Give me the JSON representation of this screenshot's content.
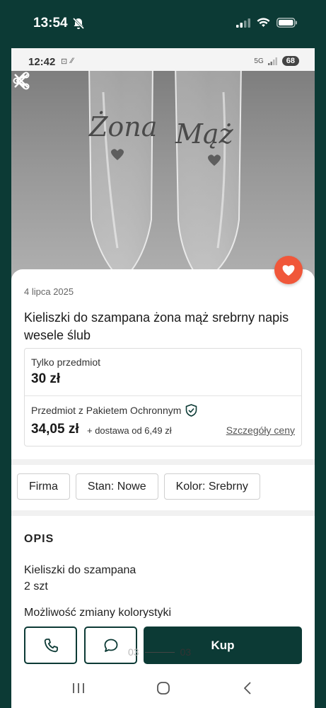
{
  "outer_status": {
    "time": "13:54"
  },
  "inner_status": {
    "time": "12:42",
    "network": "5G",
    "battery": "68"
  },
  "listing": {
    "date": "4 lipca 2025",
    "title": "Kieliszki do szampana żona mąż srebrny napis wesele ślub",
    "photo_text": {
      "left": "Żona",
      "right": "Mąż"
    },
    "price_only_label": "Tylko przedmiot",
    "price_only": "30 zł",
    "price_protected_label": "Przedmiot z Pakietem Ochronnym",
    "price_protected": "34,05 zł",
    "shipping": "+ dostawa od 6,49 zł",
    "price_details_link": "Szczegóły ceny"
  },
  "attributes": [
    "Firma",
    "Stan: Nowe",
    "Kolor: Srebrny"
  ],
  "description": {
    "heading": "OPIS",
    "line1": "Kieliszki do szampana",
    "line2": "2 szt",
    "line3": "Możliwość zmiany kolorystyki"
  },
  "actions": {
    "buy_label": "Kup"
  },
  "pager": {
    "left": "03",
    "right": "03"
  },
  "colors": {
    "brand": "#0c3a35",
    "favorite": "#f0573a"
  },
  "icons": [
    "close-icon",
    "back-arrow-icon",
    "share-icon",
    "heart-icon",
    "shield-check-icon",
    "phone-icon",
    "chat-icon",
    "recents-icon",
    "home-icon",
    "nav-back-icon"
  ]
}
